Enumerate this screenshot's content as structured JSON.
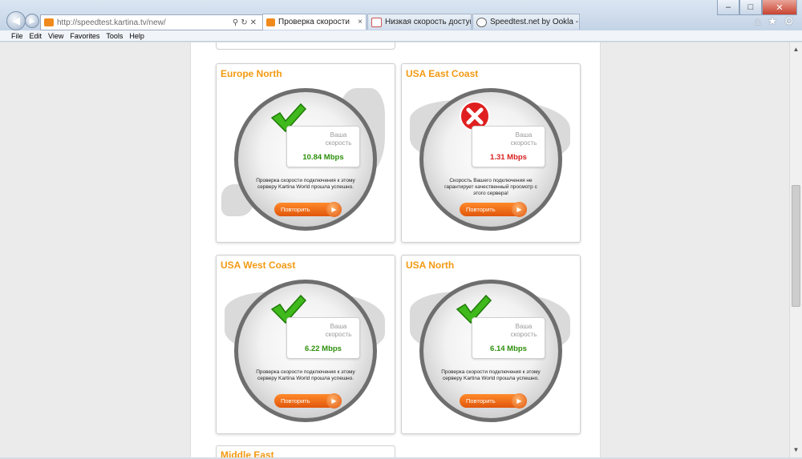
{
  "browser": {
    "url": "http://speedtest.kartina.tv/new/",
    "tabs": [
      {
        "label": "Проверка скорости",
        "close": "×"
      },
      {
        "label": "Низкая скорость доступа к се...",
        "close": ""
      },
      {
        "label": "Speedtest.net by Ookla - The G...",
        "close": ""
      }
    ],
    "menu": [
      "File",
      "Edit",
      "View",
      "Favorites",
      "Tools",
      "Help"
    ],
    "icons": {
      "back": "back-arrow-icon",
      "forward": "forward-arrow-icon",
      "search": "search-icon",
      "refresh": "refresh-icon",
      "home": "home-icon",
      "favorites": "star-icon",
      "tools": "gear-icon"
    }
  },
  "colors": {
    "title": "#f39a12",
    "ok": "#2c8f0c",
    "bad": "#d92020",
    "button": "#ef6c15"
  },
  "speed_label": "Ваша скорость",
  "retry_label": "Повторить",
  "cards": [
    {
      "title": "Europe North",
      "status": "ok",
      "speed": "10.84 Mbps",
      "message": "Проверка скорости подключения к этому серверу Kartina World прошла успешно."
    },
    {
      "title": "USA East Coast",
      "status": "bad",
      "speed": "1.31 Mbps",
      "message": "Скорость Вашего подключения не гарантирует качественный просмотр с этого сервера!"
    },
    {
      "title": "USA West Coast",
      "status": "ok",
      "speed": "6.22 Mbps",
      "message": "Проверка скорости подключения к этому серверу Kartina World прошла успешно."
    },
    {
      "title": "USA North",
      "status": "ok",
      "speed": "6.14 Mbps",
      "message": "Проверка скорости подключения к этому серверу Kartina World прошла успешно."
    }
  ],
  "next_card": {
    "title": "Middle East"
  }
}
